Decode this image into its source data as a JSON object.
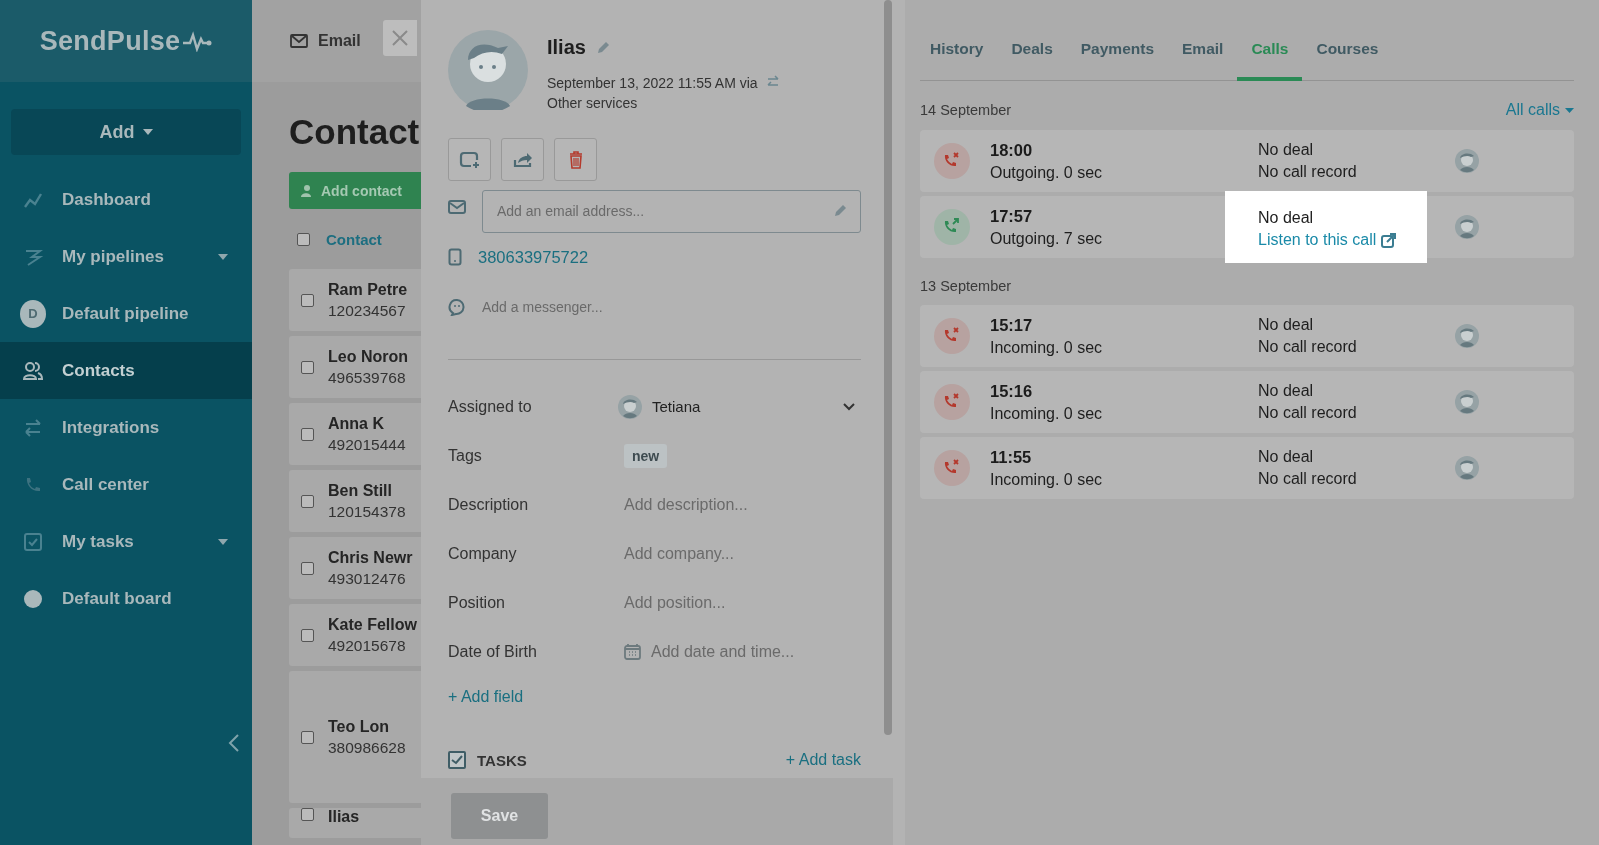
{
  "sidebar": {
    "logo": "SendPulse",
    "add_button": "Add",
    "items": [
      {
        "label": "Dashboard",
        "selected": false,
        "has_menu": false
      },
      {
        "label": "My pipelines",
        "selected": false,
        "has_menu": true
      },
      {
        "label": "Default pipeline",
        "badge": "D",
        "selected": false,
        "has_menu": false
      },
      {
        "label": "Contacts",
        "selected": true,
        "has_menu": false
      },
      {
        "label": "Integrations",
        "selected": false,
        "has_menu": false
      },
      {
        "label": "Call center",
        "selected": false,
        "has_menu": false
      },
      {
        "label": "My tasks",
        "selected": false,
        "has_menu": true
      },
      {
        "label": "Default board",
        "selected": false,
        "has_menu": false
      }
    ]
  },
  "contacts": {
    "tab": "Email",
    "title": "Contact",
    "add_button": "Add contact",
    "column": "Contact",
    "all_checked": false,
    "rows": [
      {
        "name": "Ram Petre",
        "phone": "120234567",
        "checked": false
      },
      {
        "name": "Leo Noron",
        "phone": "496539768",
        "checked": false
      },
      {
        "name": "Anna K",
        "phone": "492015444",
        "checked": false
      },
      {
        "name": "Ben Still",
        "phone": "120154378",
        "checked": false
      },
      {
        "name": "Chris Newr",
        "phone": "493012476",
        "checked": false
      },
      {
        "name": "Kate Fellow",
        "phone": "492015678",
        "checked": false
      },
      {
        "name": "Teo Lon",
        "phone": "380986628",
        "checked": false
      },
      {
        "name": "Ilias",
        "phone": "",
        "checked": false
      }
    ]
  },
  "contact_card": {
    "name": "Ilias",
    "created": "September 13, 2022 11:55 AM via",
    "source": "Other services",
    "email_placeholder": "Add an email address...",
    "phone": "380633975722",
    "messenger_placeholder": "Add a messenger...",
    "fields": [
      {
        "label": "Assigned to",
        "kind": "user",
        "value": "Tetiana"
      },
      {
        "label": "Tags",
        "kind": "tag",
        "value": "new"
      },
      {
        "label": "Description",
        "kind": "text",
        "placeholder": "Add description..."
      },
      {
        "label": "Company",
        "kind": "text",
        "placeholder": "Add company..."
      },
      {
        "label": "Position",
        "kind": "text",
        "placeholder": "Add position..."
      },
      {
        "label": "Date of Birth",
        "kind": "date",
        "placeholder": "Add date and time..."
      }
    ],
    "add_field": "+ Add field",
    "tasks": {
      "label": "TASKS",
      "checked": true,
      "add": "+ Add task"
    },
    "save_button": {
      "label": "Save",
      "disabled": true
    }
  },
  "activity": {
    "tabs": [
      {
        "label": "History",
        "selected": false
      },
      {
        "label": "Deals",
        "selected": false
      },
      {
        "label": "Payments",
        "selected": false
      },
      {
        "label": "Email",
        "selected": false
      },
      {
        "label": "Calls",
        "selected": true
      },
      {
        "label": "Courses",
        "selected": false
      }
    ],
    "filter": "All calls",
    "groups": [
      {
        "date": "14 September",
        "calls": [
          {
            "time": "18:00",
            "summary": "Outgoing. 0 sec",
            "kind": "missed",
            "deal": "No deal",
            "record": "No call record",
            "record_link": false,
            "highlighted": false
          },
          {
            "time": "17:57",
            "summary": "Outgoing. 7 sec",
            "kind": "answered",
            "deal": "No deal",
            "record": "Listen to this call",
            "record_link": true,
            "highlighted": true
          }
        ]
      },
      {
        "date": "13 September",
        "calls": [
          {
            "time": "15:17",
            "summary": "Incoming. 0 sec",
            "kind": "missed",
            "deal": "No deal",
            "record": "No call record",
            "record_link": false,
            "highlighted": false
          },
          {
            "time": "15:16",
            "summary": "Incoming. 0 sec",
            "kind": "missed",
            "deal": "No deal",
            "record": "No call record",
            "record_link": false,
            "highlighted": false
          },
          {
            "time": "11:55",
            "summary": "Incoming. 0 sec",
            "kind": "missed",
            "deal": "No deal",
            "record": "No call record",
            "record_link": false,
            "highlighted": false
          }
        ]
      }
    ]
  }
}
